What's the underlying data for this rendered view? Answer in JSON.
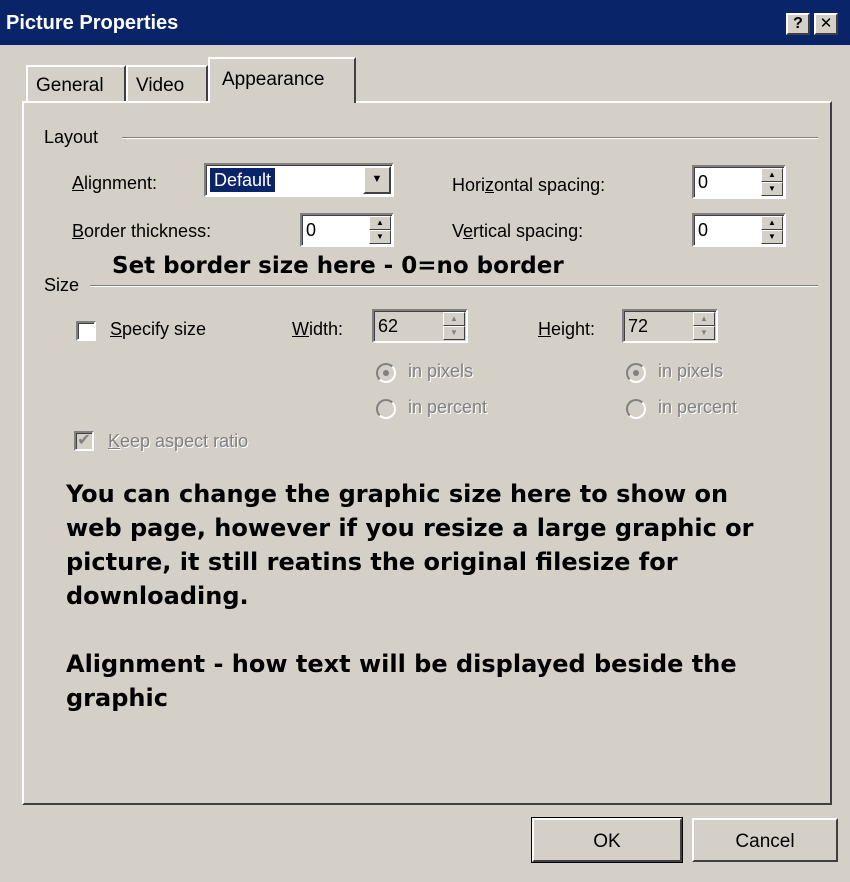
{
  "window": {
    "title": "Picture Properties",
    "help_glyph": "?",
    "close_glyph": "✕"
  },
  "tabs": [
    {
      "label": "General",
      "active": false
    },
    {
      "label": "Video",
      "active": false
    },
    {
      "label": "Appearance",
      "active": true
    }
  ],
  "layout": {
    "group_label": "Layout",
    "alignment": {
      "label_pre": "",
      "label_key": "A",
      "label_rest": "lignment:",
      "value": "Default"
    },
    "border_thickness": {
      "label_key": "B",
      "label_rest": "order thickness:",
      "value": "0"
    },
    "horizontal_spacing": {
      "label_pre": "Hori",
      "label_key": "z",
      "label_rest": "ontal spacing:",
      "value": "0"
    },
    "vertical_spacing": {
      "label_pre": "V",
      "label_key": "e",
      "label_rest": "rtical spacing:",
      "value": "0"
    }
  },
  "size": {
    "group_label": "Size",
    "specify_size": {
      "label_key": "S",
      "label_rest": "pecify size",
      "checked": false
    },
    "width": {
      "label_key": "W",
      "label_rest": "idth:",
      "value": "62"
    },
    "height": {
      "label_key": "H",
      "label_rest": "eight:",
      "value": "72"
    },
    "width_units": {
      "in_pixels": "in pixels",
      "in_percent": "in percent",
      "selected": "in pixels"
    },
    "height_units": {
      "in_pixels": "in pixels",
      "in_percent": "in percent",
      "selected": "in pixels"
    },
    "keep_aspect": {
      "label_key": "K",
      "label_rest": "eep aspect ratio",
      "checked": true
    }
  },
  "annotations": {
    "border_note": "Set border size here - 0=no border",
    "size_note": "You can change the graphic size here to show on web page, however if you resize a large graphic or picture, it still reatins the original filesize for downloading.",
    "alignment_note": "Alignment - how text will be displayed beside the graphic"
  },
  "buttons": {
    "ok": "OK",
    "cancel": "Cancel"
  }
}
